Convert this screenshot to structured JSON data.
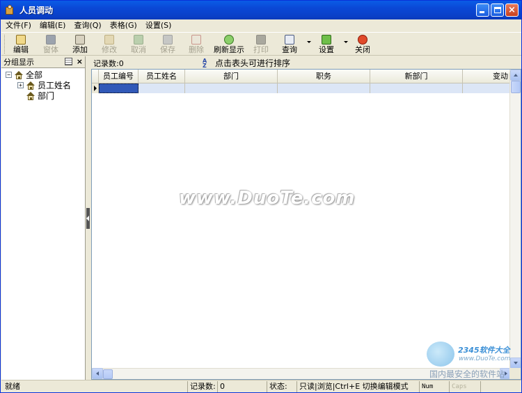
{
  "window": {
    "title": "人员调动"
  },
  "menu": [
    "文件(F)",
    "编辑(E)",
    "查询(Q)",
    "表格(G)",
    "设置(S)"
  ],
  "toolbar": {
    "edit": "编辑",
    "window": "窗体",
    "add": "添加",
    "modify": "修改",
    "cancel": "取消",
    "save": "保存",
    "delete": "删除",
    "refresh": "刷新显示",
    "print": "打印",
    "query": "查询",
    "settings": "设置",
    "close": "关闭"
  },
  "left_panel": {
    "title": "分组显示",
    "tree": {
      "root": "全部",
      "child1": "员工姓名",
      "child2": "部门"
    }
  },
  "right_panel": {
    "record_count_label": "记录数:0",
    "sort_hint": "点击表头可进行排序"
  },
  "table": {
    "columns": [
      "员工编号",
      "员工姓名",
      "部门",
      "职务",
      "新部门",
      "变动日期"
    ]
  },
  "watermarks": {
    "main": "www.DuoTe.com",
    "brand": "2345软件大全",
    "url": "www.DuoTe.com",
    "slogan": "国内最安全的软件站"
  },
  "statusbar": {
    "ready": "就绪",
    "record_label": "记录数:",
    "record_value": "0",
    "state_label": "状态:",
    "state_value": "只读|浏览|Ctrl+E 切换编辑模式",
    "num": "Num",
    "caps": "Caps"
  },
  "colors": {
    "titlebar": "#0a48d6",
    "selection": "#3159b8",
    "row_highlight": "#dce6f6"
  }
}
